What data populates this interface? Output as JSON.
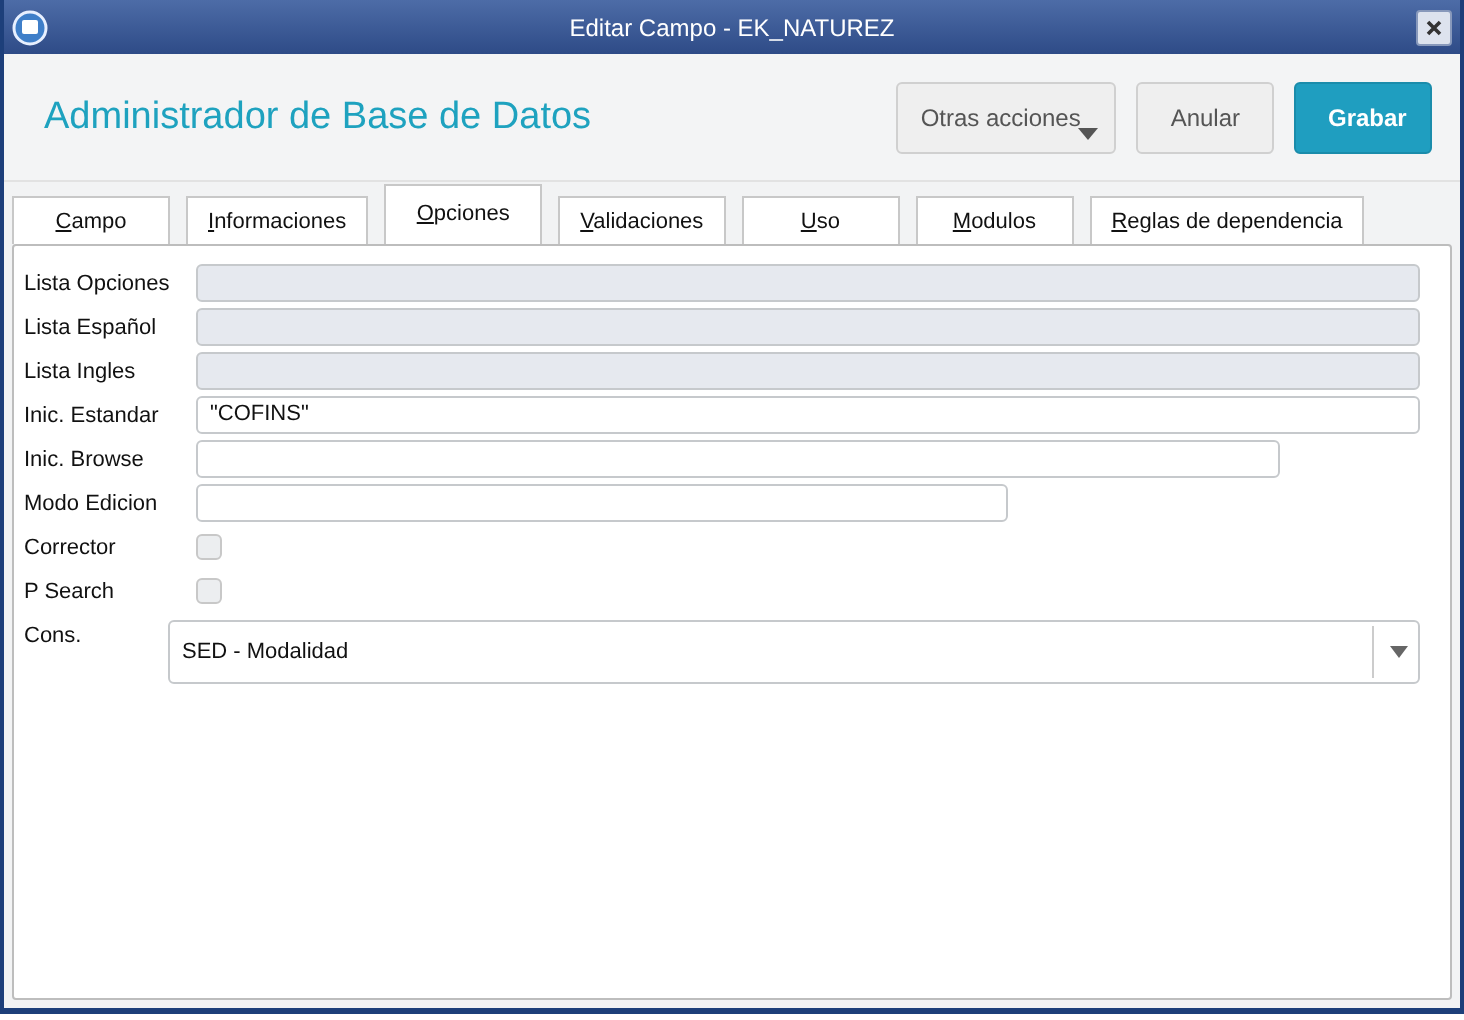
{
  "window": {
    "title": "Editar Campo - EK_NATUREZ"
  },
  "header": {
    "title": "Administrador de Base de Datos",
    "buttons": [
      {
        "label": "Otras acciones",
        "kind": "menu"
      },
      {
        "label": "Anular",
        "kind": "plain"
      },
      {
        "label": "Grabar",
        "kind": "primary"
      }
    ]
  },
  "tabs": [
    {
      "label": "Campo",
      "selected": false
    },
    {
      "label": "Informaciones",
      "selected": false
    },
    {
      "label": "Opciones",
      "selected": true
    },
    {
      "label": "Validaciones",
      "selected": false
    },
    {
      "label": "Uso",
      "selected": false
    },
    {
      "label": "Modulos",
      "selected": false
    },
    {
      "label": "Reglas de dependencia",
      "selected": false
    }
  ],
  "fields": [
    {
      "label": "Lista Opciones",
      "kind": "text",
      "disabled": true
    },
    {
      "label": "Lista Español",
      "kind": "text",
      "disabled": true
    },
    {
      "label": "Lista Ingles",
      "kind": "text",
      "disabled": true
    },
    {
      "label": "Inic. Estandar",
      "kind": "text",
      "disabled": false,
      "value": "\"COFINS\""
    },
    {
      "label": "Inic. Browse",
      "kind": "text",
      "disabled": false
    },
    {
      "label": "Modo Edicion",
      "kind": "text",
      "disabled": false
    },
    {
      "label": "Corrector",
      "kind": "checkbox",
      "checked": false
    },
    {
      "label": "P Search",
      "kind": "checkbox",
      "checked": false
    },
    {
      "label": "Cons.",
      "kind": "select",
      "value": "SED - Modalidad"
    }
  ]
}
